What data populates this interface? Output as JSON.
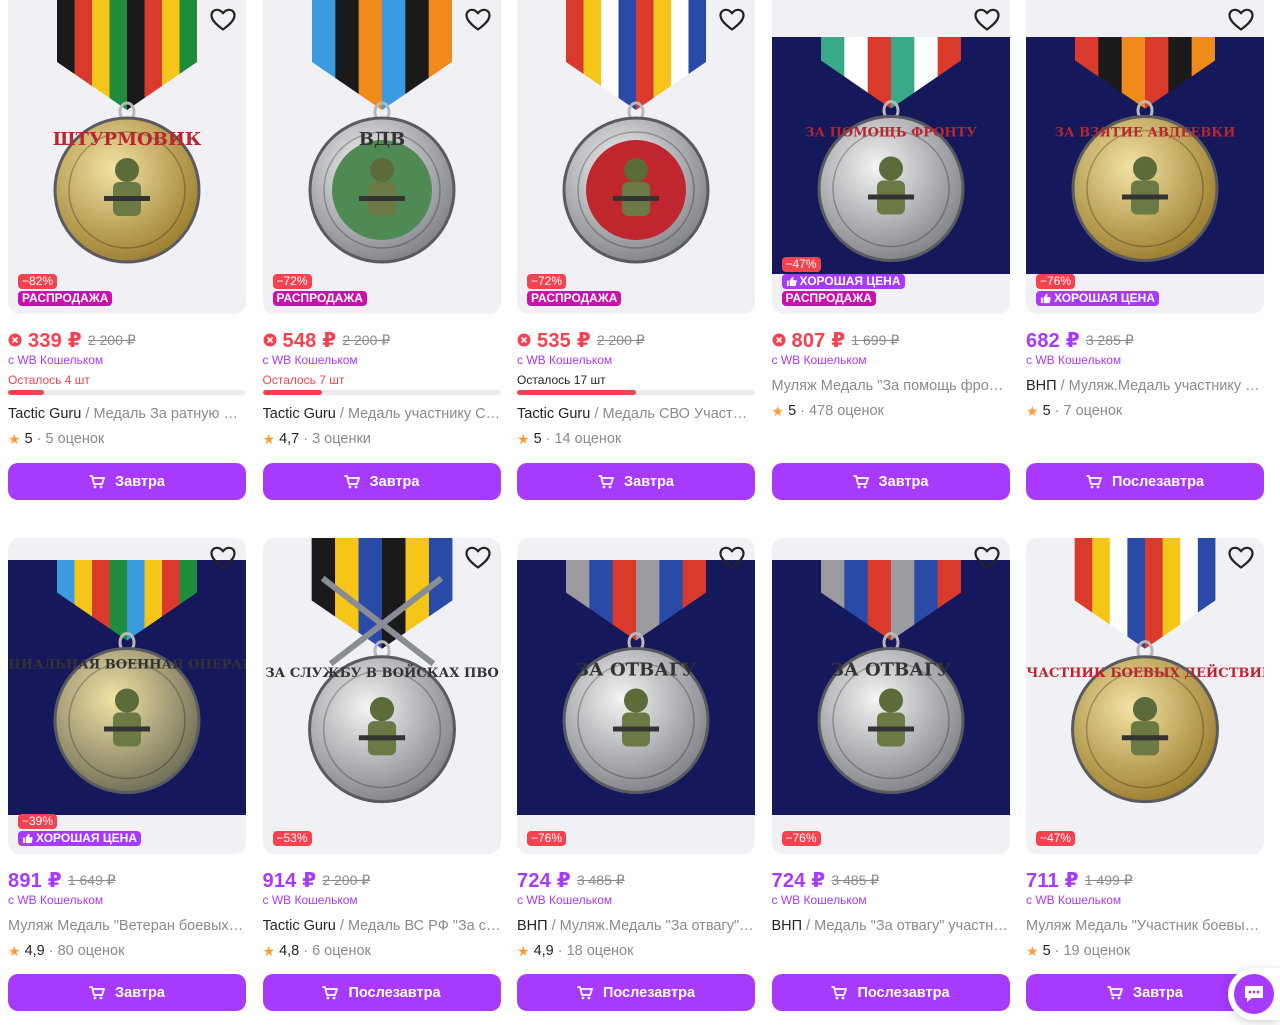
{
  "colors": {
    "accent": "#a73afd",
    "discount": "#f6424e",
    "sale": "#cb11ab",
    "star": "#ff9c33",
    "muted": "#8b8b8b"
  },
  "products": [
    {
      "discount": "−82%",
      "good_price": "",
      "sale": "РАСПРОДАЖА",
      "price": "339 ₽",
      "old_price": "2 200 ₽",
      "price_red": true,
      "wallet": "с WB Кошельком",
      "left": "Осталось 4 шт",
      "left_fill": 0.15,
      "left_red": true,
      "brand": "Tactic Guru",
      "name": "Медаль За ратную доблесть",
      "rating": "5",
      "reviews": "5 оценок",
      "delivery": "Завтра",
      "medal": {
        "style": "gold",
        "inscription": "ШТУРМОВИК",
        "ribbon": [
          "#1a1a1a",
          "#d93a2b",
          "#f5c518",
          "#1e8c3a"
        ]
      }
    },
    {
      "discount": "−72%",
      "good_price": "",
      "sale": "РАСПРОДАЖА",
      "price": "548 ₽",
      "old_price": "2 200 ₽",
      "price_red": true,
      "wallet": "с WB Кошельком",
      "left": "Осталось 7 шт",
      "left_fill": 0.25,
      "left_red": true,
      "brand": "Tactic Guru",
      "name": "Медаль участнику СВО ВДВ",
      "rating": "4,7",
      "reviews": "3 оценки",
      "delivery": "Завтра",
      "medal": {
        "style": "silver",
        "inscription": "ВДВ",
        "ribbon": [
          "#3a9be0",
          "#1a1a1a",
          "#f08a1a"
        ]
      }
    },
    {
      "discount": "−72%",
      "good_price": "",
      "sale": "РАСПРОДАЖА",
      "price": "535 ₽",
      "old_price": "2 200 ₽",
      "price_red": true,
      "wallet": "с WB Кошельком",
      "left": "Осталось 17 шт",
      "left_fill": 0.5,
      "left_red": false,
      "brand": "Tactic Guru",
      "name": "Медаль СВО Участник боевых действий",
      "rating": "5",
      "reviews": "14 оценок",
      "delivery": "Завтра",
      "medal": {
        "style": "red",
        "inscription": "",
        "ribbon": [
          "#d93a2b",
          "#f5c518",
          "#ffffff",
          "#2a4aa8"
        ]
      }
    },
    {
      "discount": "−47%",
      "good_price": "ХОРОШАЯ ЦЕНА",
      "sale": "РАСПРОДАЖА",
      "price": "807 ₽",
      "old_price": "1 699 ₽",
      "price_red": true,
      "wallet": "с WB Кошельком",
      "left": "",
      "left_fill": 0,
      "left_red": true,
      "brand": "",
      "name": "Муляж Медаль \"За помощь фронту\"",
      "rating": "5",
      "reviews": "478 оценок",
      "delivery": "Завтра",
      "medal": {
        "style": "silver-navy",
        "inscription": "ЗА ПОМОЩЬ ФРОНТУ",
        "ribbon": [
          "#3aa98a",
          "#ffffff",
          "#d93a2b"
        ]
      }
    },
    {
      "discount": "−76%",
      "good_price": "ХОРОШАЯ ЦЕНА",
      "sale": "",
      "price": "682 ₽",
      "old_price": "3 285 ₽",
      "price_red": false,
      "wallet": "с WB Кошельком",
      "left": "",
      "left_fill": 0,
      "left_red": true,
      "brand": "ВНП",
      "name": "Муляж.Медаль участнику штурма",
      "rating": "5",
      "reviews": "7 оценок",
      "delivery": "Послезавтра",
      "medal": {
        "style": "gold-navy",
        "inscription": "ЗА ВЗЯТИЕ АВДЕЕВКИ",
        "ribbon": [
          "#d93a2b",
          "#1a1a1a",
          "#f08a1a"
        ]
      }
    },
    {
      "discount": "−39%",
      "good_price": "ХОРОШАЯ ЦЕНА",
      "sale": "",
      "price": "891 ₽",
      "old_price": "1 649 ₽",
      "price_red": false,
      "wallet": "с WB Кошельком",
      "left": "",
      "left_fill": 0,
      "left_red": true,
      "brand": "",
      "name": "Муляж Медаль \"Ветеран боевых действий\"",
      "rating": "4,9",
      "reviews": "80 оценок",
      "delivery": "Завтра",
      "medal": {
        "style": "bronze-navy",
        "inscription": "СПЕЦИАЛЬНАЯ ВОЕННАЯ ОПЕРАЦИЯ",
        "ribbon": [
          "#3a9be0",
          "#f5c518",
          "#d93a2b",
          "#1e8c3a"
        ]
      }
    },
    {
      "discount": "−53%",
      "good_price": "",
      "sale": "",
      "price": "914 ₽",
      "old_price": "2 200 ₽",
      "price_red": false,
      "wallet": "с WB Кошельком",
      "left": "",
      "left_fill": 0,
      "left_red": true,
      "brand": "Tactic Guru",
      "name": "Медаль ВС РФ \"За службу в войсках ПВО\"",
      "rating": "4,8",
      "reviews": "6 оценок",
      "delivery": "Послезавтра",
      "medal": {
        "style": "silver-swords",
        "inscription": "ЗА СЛУЖБУ В ВОЙСКАХ ПВО",
        "ribbon": [
          "#1a1a1a",
          "#f5c518",
          "#2a4aa8"
        ]
      }
    },
    {
      "discount": "−76%",
      "good_price": "",
      "sale": "",
      "price": "724 ₽",
      "old_price": "3 485 ₽",
      "price_red": false,
      "wallet": "с WB Кошельком",
      "left": "",
      "left_fill": 0,
      "left_red": true,
      "brand": "ВНП",
      "name": "Муляж.Медаль \"За отвагу\" участнику СВО",
      "rating": "4,9",
      "reviews": "18 оценок",
      "delivery": "Послезавтра",
      "medal": {
        "style": "silver-navy-big",
        "inscription": "ЗА ОТВАГУ",
        "ribbon": [
          "#9a9aa0",
          "#2a4aa8",
          "#d93a2b"
        ]
      }
    },
    {
      "discount": "−76%",
      "good_price": "",
      "sale": "",
      "price": "724 ₽",
      "old_price": "3 485 ₽",
      "price_red": false,
      "wallet": "с WB Кошельком",
      "left": "",
      "left_fill": 0,
      "left_red": true,
      "brand": "ВНП",
      "name": "Медаль \"За отвагу\" участнику СВО",
      "rating": "",
      "reviews": "",
      "delivery": "Послезавтра",
      "medal": {
        "style": "silver-navy-big",
        "inscription": "ЗА ОТВАГУ",
        "ribbon": [
          "#9a9aa0",
          "#2a4aa8",
          "#d93a2b"
        ]
      }
    },
    {
      "discount": "−47%",
      "good_price": "",
      "sale": "",
      "price": "711 ₽",
      "old_price": "1 499 ₽",
      "price_red": false,
      "wallet": "с WB Кошельком",
      "left": "",
      "left_fill": 0,
      "left_red": true,
      "brand": "",
      "name": "Муляж Медаль \"Участник боевых действий\"",
      "rating": "5",
      "reviews": "19 оценок",
      "delivery": "Завтра",
      "medal": {
        "style": "silver-gold",
        "inscription": "УЧАСТНИК БОЕВЫХ ДЕЙСТВИЙ",
        "ribbon": [
          "#d93a2b",
          "#f5c518",
          "#ffffff",
          "#2a4aa8"
        ]
      }
    }
  ]
}
